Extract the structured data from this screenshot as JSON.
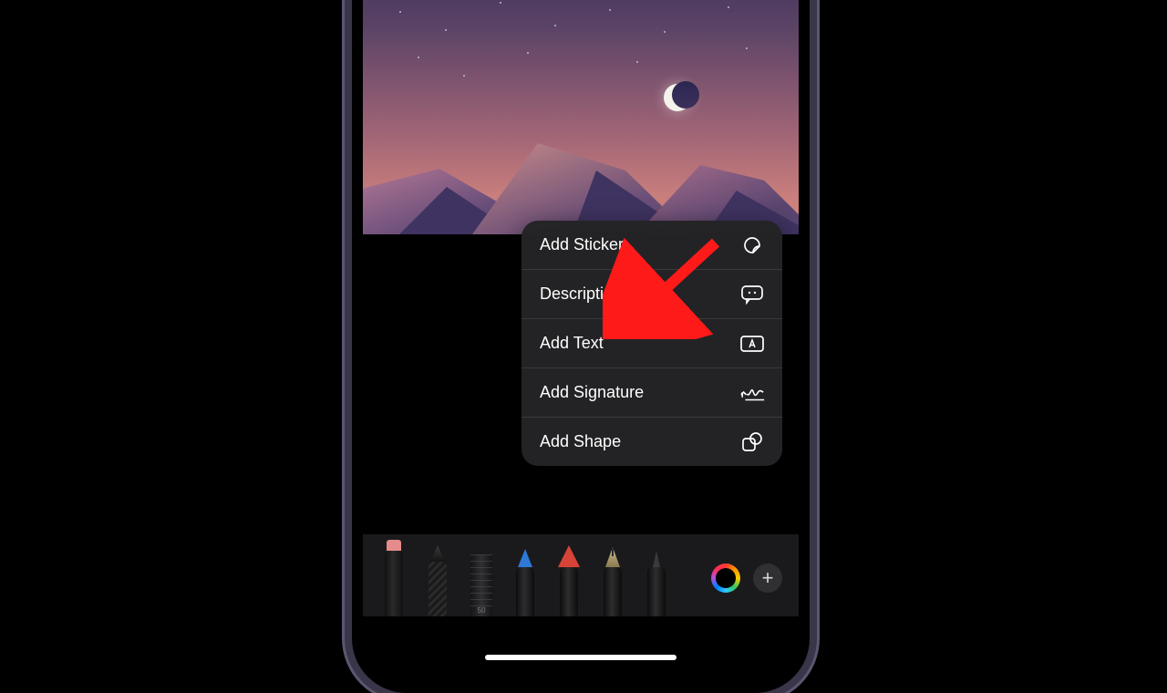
{
  "menu": {
    "items": [
      {
        "label": "Add Sticker",
        "icon": "sticker-icon"
      },
      {
        "label": "Description",
        "icon": "speech-bubble-icon"
      },
      {
        "label": "Add Text",
        "icon": "text-box-icon"
      },
      {
        "label": "Add Signature",
        "icon": "signature-icon"
      },
      {
        "label": "Add Shape",
        "icon": "shapes-icon"
      }
    ]
  },
  "toolbar": {
    "tools": [
      "marker",
      "hatch-pen",
      "ruler",
      "blue-pencil",
      "red-crayon",
      "fountain-pen",
      "fine-liner"
    ],
    "ruler_value": "50",
    "plus_label": "+"
  },
  "annotation": {
    "arrow_target": "Add Text"
  }
}
